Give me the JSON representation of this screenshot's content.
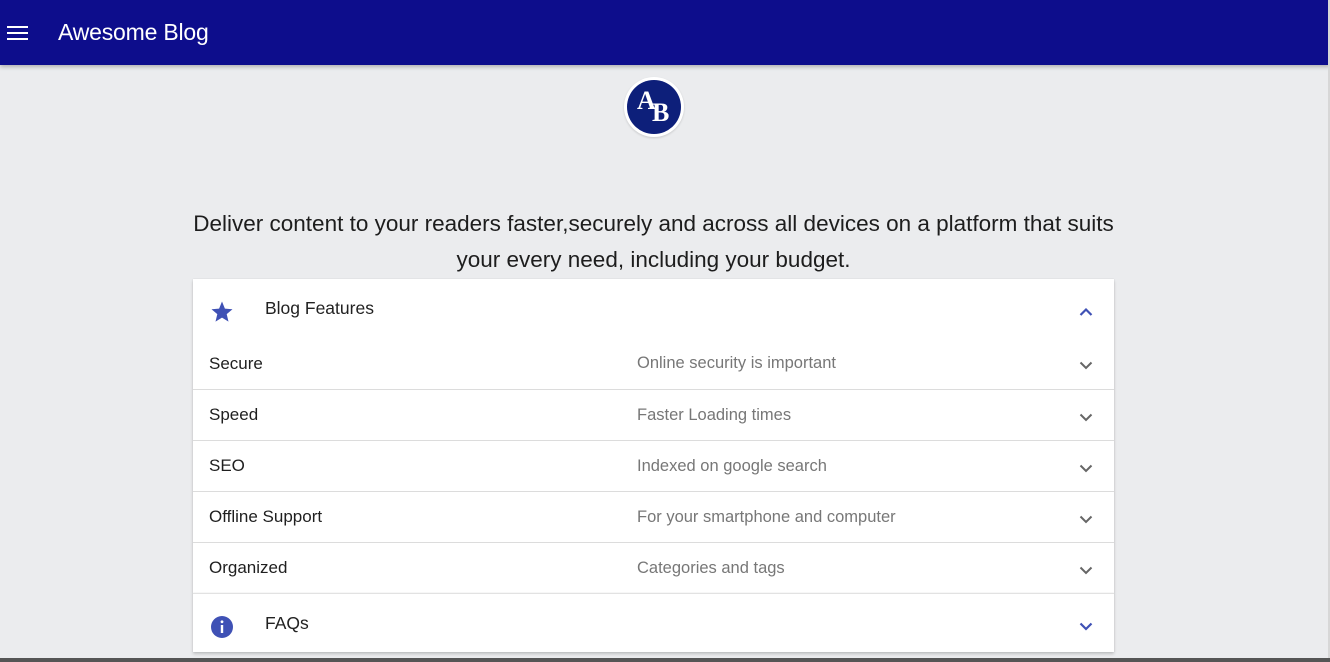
{
  "app": {
    "title": "Awesome Blog",
    "menu_icon": "hamburger-menu-icon",
    "toolbar_color": "#0d0d8c"
  },
  "logo": {
    "letters": "AB",
    "background": "#0d1f7a"
  },
  "tagline": "Deliver content to your readers faster,securely and across all devices on a platform that suits your every need, including your budget.",
  "features_panel": {
    "title": "Blog Features",
    "icon": "star-icon",
    "expanded": true,
    "items": [
      {
        "title": "Secure",
        "description": "Online security is important"
      },
      {
        "title": "Speed",
        "description": "Faster Loading times"
      },
      {
        "title": "SEO",
        "description": "Indexed on google search"
      },
      {
        "title": "Offline Support",
        "description": "For your smartphone and computer"
      },
      {
        "title": "Organized",
        "description": "Categories and tags"
      }
    ]
  },
  "faq_panel": {
    "title": "FAQs",
    "icon": "info-icon",
    "expanded": false
  },
  "accent_color": "#3f51b5"
}
